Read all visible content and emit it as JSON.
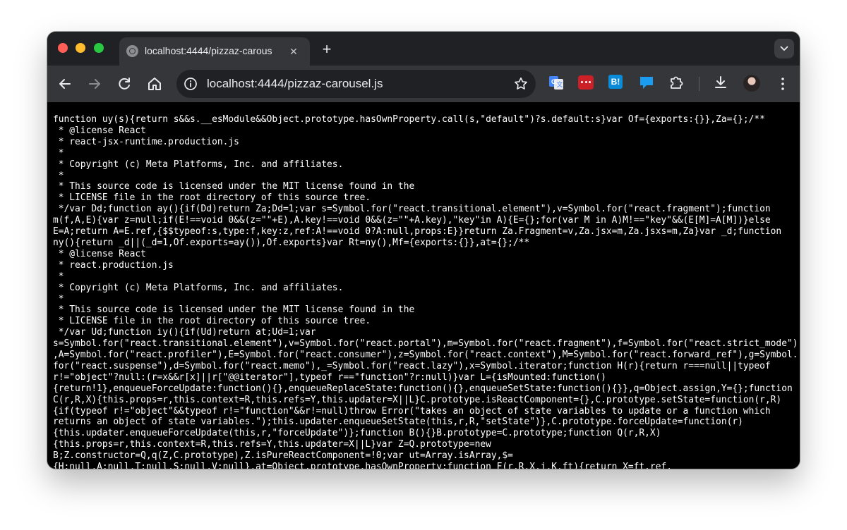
{
  "tab": {
    "title": "localhost:4444/pizzaz-carous",
    "close_glyph": "✕",
    "favicon_icon": "globe-icon"
  },
  "new_tab_glyph": "+",
  "omnibox": {
    "url": "localhost:4444/pizzaz-carousel.js"
  },
  "extensions": {
    "hatena_label": "B!"
  },
  "source_lines": [
    "function uy(s){return s&&s.__esModule&&Object.prototype.hasOwnProperty.call(s,\"default\")?s.default:s}var Of={exports:{}},Za={};/**",
    " * @license React",
    " * react-jsx-runtime.production.js",
    " *",
    " * Copyright (c) Meta Platforms, Inc. and affiliates.",
    " *",
    " * This source code is licensed under the MIT license found in the",
    " * LICENSE file in the root directory of this source tree.",
    " */var Dd;function ay(){if(Dd)return Za;Dd=1;var s=Symbol.for(\"react.transitional.element\"),v=Symbol.for(\"react.fragment\");function",
    "m(f,A,E){var z=null;if(E!==void 0&&(z=\"\"+E),A.key!==void 0&&(z=\"\"+A.key),\"key\"in A){E={};for(var M in A)M!==\"key\"&&(E[M]=A[M])}else",
    "E=A;return A=E.ref,{$$typeof:s,type:f,key:z,ref:A!==void 0?A:null,props:E}}return Za.Fragment=v,Za.jsx=m,Za.jsxs=m,Za}var _d;function",
    "ny(){return _d||(_d=1,Of.exports=ay()),Of.exports}var Rt=ny(),Mf={exports:{}},at={};/**",
    " * @license React",
    " * react.production.js",
    " *",
    " * Copyright (c) Meta Platforms, Inc. and affiliates.",
    " *",
    " * This source code is licensed under the MIT license found in the",
    " * LICENSE file in the root directory of this source tree.",
    " */var Ud;function iy(){if(Ud)return at;Ud=1;var",
    "s=Symbol.for(\"react.transitional.element\"),v=Symbol.for(\"react.portal\"),m=Symbol.for(\"react.fragment\"),f=Symbol.for(\"react.strict_mode\")",
    ",A=Symbol.for(\"react.profiler\"),E=Symbol.for(\"react.consumer\"),z=Symbol.for(\"react.context\"),M=Symbol.for(\"react.forward_ref\"),g=Symbol.",
    "for(\"react.suspense\"),d=Symbol.for(\"react.memo\"),_=Symbol.for(\"react.lazy\"),x=Symbol.iterator;function H(r){return r===null||typeof",
    "r!=\"object\"?null:(r=x&&r[x]||r[\"@@iterator\"],typeof r==\"function\"?r:null)}var L={isMounted:function()",
    "{return!1},enqueueForceUpdate:function(){},enqueueReplaceState:function(){},enqueueSetState:function(){}},q=Object.assign,Y={};function",
    "C(r,R,X){this.props=r,this.context=R,this.refs=Y,this.updater=X||L}C.prototype.isReactComponent={},C.prototype.setState=function(r,R)",
    "{if(typeof r!=\"object\"&&typeof r!=\"function\"&&r!=null)throw Error(\"takes an object of state variables to update or a function which",
    "returns an object of state variables.\");this.updater.enqueueSetState(this,r,R,\"setState\")},C.prototype.forceUpdate=function(r)",
    "{this.updater.enqueueForceUpdate(this,r,\"forceUpdate\")};function B(){}B.prototype=C.prototype;function Q(r,R,X)",
    "{this.props=r,this.context=R,this.refs=Y,this.updater=X||L}var Z=Q.prototype=new",
    "B;Z.constructor=Q,q(Z,C.prototype),Z.isPureReactComponent=!0;var ut=Array.isArray,$=",
    "{H:null,A:null,T:null,S:null,V:null},at=Object.prototype.hasOwnProperty;function F(r,R,X,j,K,ft){return X=ft.ref,"
  ]
}
